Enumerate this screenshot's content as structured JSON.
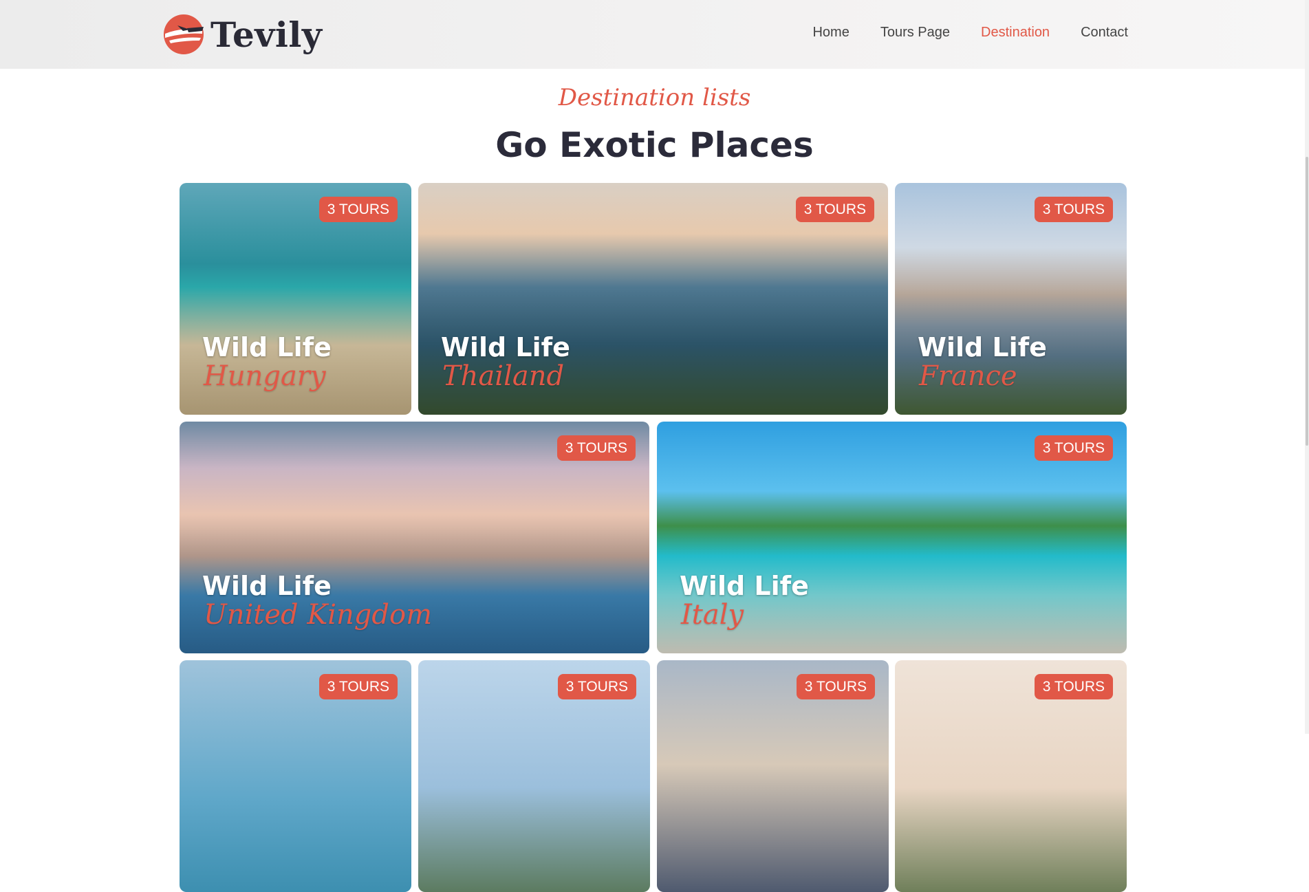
{
  "header": {
    "logo_text": "Tevily",
    "nav": [
      {
        "label": "Home",
        "active": false
      },
      {
        "label": "Tours Page",
        "active": false
      },
      {
        "label": "Destination",
        "active": true
      },
      {
        "label": "Contact",
        "active": false
      }
    ]
  },
  "section": {
    "subtitle": "Destination lists",
    "title": "Go Exotic Places"
  },
  "colors": {
    "accent": "#e15847",
    "heading": "#2b2b3a"
  },
  "destinations": [
    {
      "badge": "3 TOURS",
      "title": "Wild Life",
      "place": "Hungary"
    },
    {
      "badge": "3 TOURS",
      "title": "Wild Life",
      "place": "Thailand"
    },
    {
      "badge": "3 TOURS",
      "title": "Wild Life",
      "place": "France"
    },
    {
      "badge": "3 TOURS",
      "title": "Wild Life",
      "place": "United Kingdom"
    },
    {
      "badge": "3 TOURS",
      "title": "Wild Life",
      "place": "Italy"
    },
    {
      "badge": "3 TOURS"
    },
    {
      "badge": "3 TOURS"
    },
    {
      "badge": "3 TOURS"
    },
    {
      "badge": "3 TOURS"
    }
  ]
}
